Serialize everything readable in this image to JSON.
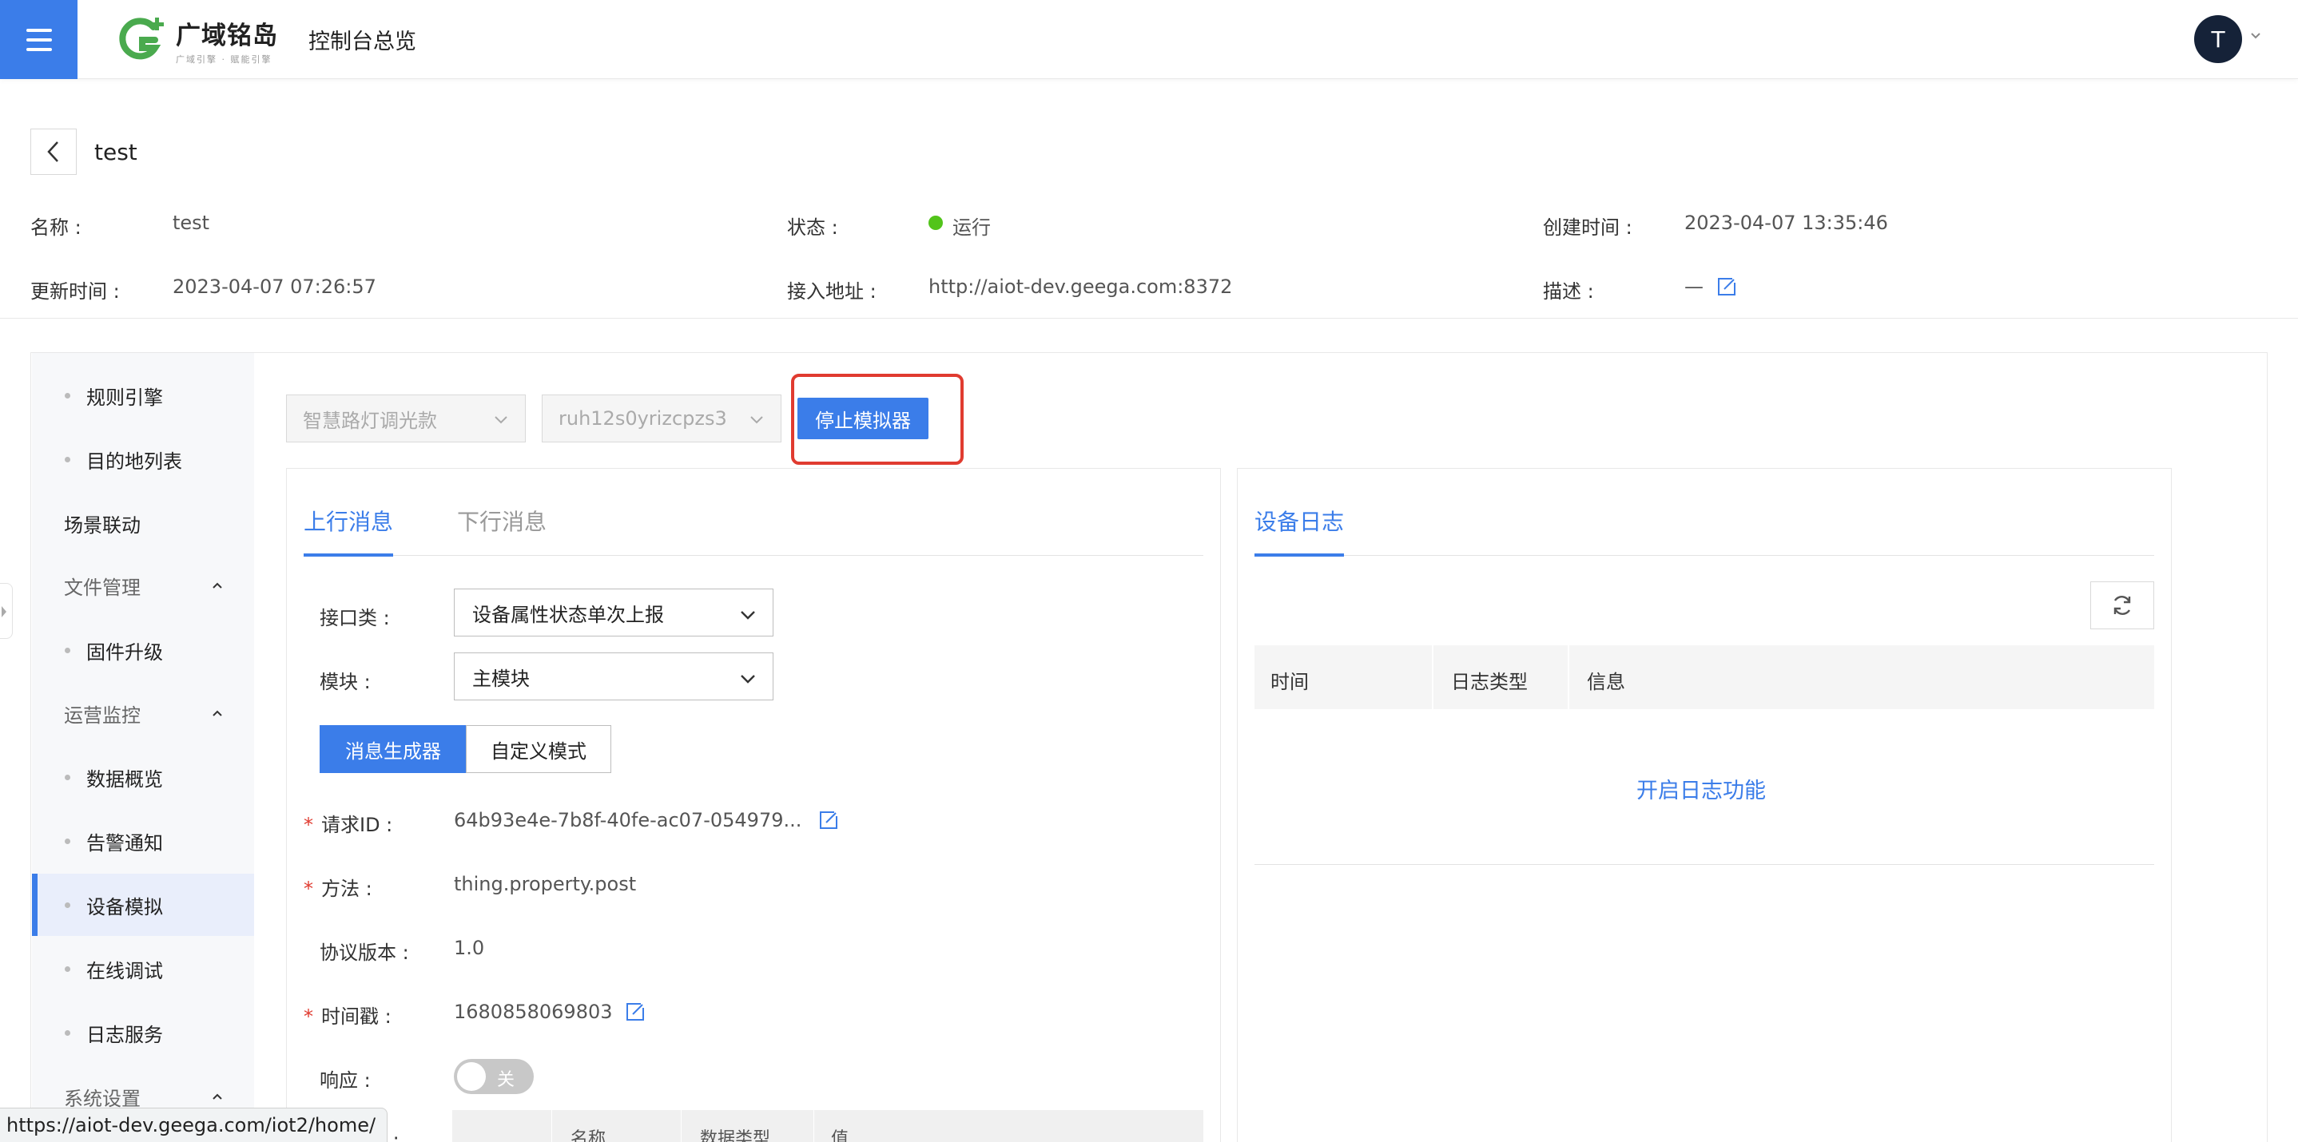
{
  "topbar": {
    "brand_name": "广域铭岛",
    "brand_sub": "广域引擎 · 赋能引擎",
    "app_title": "控制台总览",
    "avatar_initial": "T",
    "accent_color": "#3b7de9"
  },
  "header": {
    "title": "test",
    "fields": {
      "name_label": "名称 :",
      "name_value": "test",
      "status_label": "状态 :",
      "status_value": "运行",
      "created_label": "创建时间 :",
      "created_value": "2023-04-07 13:35:46",
      "updated_label": "更新时间 :",
      "updated_value": "2023-04-07 07:26:57",
      "endpoint_label": "接入地址 :",
      "endpoint_value": "http://aiot-dev.geega.com:8372",
      "desc_label": "描述 :",
      "desc_value": "—"
    }
  },
  "sidebar": {
    "items": [
      {
        "label": "规则引擎",
        "type": "child"
      },
      {
        "label": "目的地列表",
        "type": "child"
      },
      {
        "label": "场景联动",
        "type": "top"
      },
      {
        "label": "文件管理",
        "type": "group"
      },
      {
        "label": "固件升级",
        "type": "child"
      },
      {
        "label": "运营监控",
        "type": "group"
      },
      {
        "label": "数据概览",
        "type": "child"
      },
      {
        "label": "告警通知",
        "type": "child"
      },
      {
        "label": "设备模拟",
        "type": "child",
        "active": true
      },
      {
        "label": "在线调试",
        "type": "child"
      },
      {
        "label": "日志服务",
        "type": "child"
      },
      {
        "label": "系统设置",
        "type": "group"
      }
    ]
  },
  "toolbar": {
    "product_select": "智慧路灯调光款",
    "device_select": "ruh12s0yrizcpzs3",
    "stop_button": "停止模拟器"
  },
  "uplink": {
    "tabs": [
      "上行消息",
      "下行消息"
    ],
    "interface_label": "接口类 :",
    "interface_value": "设备属性状态单次上报",
    "module_label": "模块 :",
    "module_value": "主模块",
    "mode_generator": "消息生成器",
    "mode_custom": "自定义模式",
    "request_id_label": "请求ID :",
    "request_id_value": "64b93e4e-7b8f-40fe-ac07-054979...",
    "method_label": "方法 :",
    "method_value": "thing.property.post",
    "version_label": "协议版本 :",
    "version_value": "1.0",
    "timestamp_label": "时间戳 :",
    "timestamp_value": "1680858069803",
    "response_label": "响应 :",
    "response_toggle": "关",
    "params_label": "参数 :",
    "table_headers": [
      "名称",
      "数据类型",
      "值"
    ]
  },
  "device_log": {
    "tab": "设备日志",
    "columns": [
      "时间",
      "日志类型",
      "信息"
    ],
    "enable_link": "开启日志功能"
  },
  "statusbar": {
    "url": "https://aiot-dev.geega.com/iot2/home/"
  }
}
